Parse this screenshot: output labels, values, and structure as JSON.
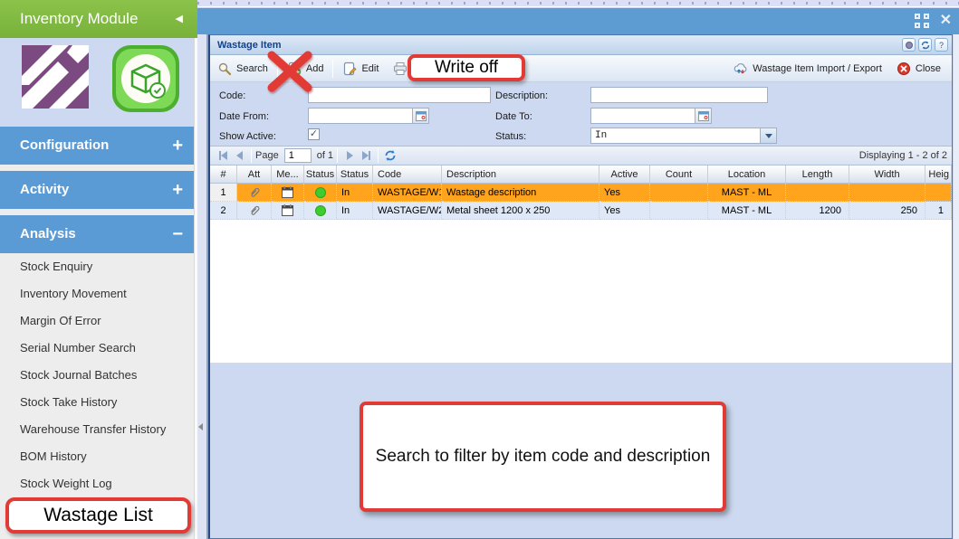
{
  "sidebar": {
    "title": "Inventory Module",
    "collapse_glyph": "◀",
    "sections": [
      {
        "label": "Configuration",
        "state_glyph": "+"
      },
      {
        "label": "Activity",
        "state_glyph": "+"
      },
      {
        "label": "Analysis",
        "state_glyph": "−"
      }
    ],
    "analysis_items": [
      "Stock Enquiry",
      "Inventory Movement",
      "Margin Of Error",
      "Serial Number Search",
      "Stock Journal Batches",
      "Stock Take History",
      "Warehouse Transfer History",
      "BOM History",
      "Stock Weight Log"
    ]
  },
  "window": {
    "close_glyph": "✕"
  },
  "panel": {
    "title": "Wastage Item",
    "header_buttons": {
      "help_label": "?"
    },
    "toolbar": {
      "search": "Search",
      "add": "Add",
      "edit": "Edit",
      "print_grid": "Print Grid",
      "import_export": "Wastage Item Import / Export",
      "close": "Close"
    },
    "filters": {
      "code_label": "Code:",
      "code_value": "",
      "description_label": "Description:",
      "description_value": "",
      "date_from_label": "Date From:",
      "date_from_value": "",
      "date_to_label": "Date To:",
      "date_to_value": "",
      "show_active_label": "Show Active:",
      "show_active_check": "✓",
      "status_label": "Status:",
      "status_value": "In"
    },
    "pager": {
      "page_label": "Page",
      "page_value": "1",
      "of_label": "of 1",
      "displaying": "Displaying 1 - 2 of 2"
    },
    "grid": {
      "columns": [
        "#",
        "Att",
        "Me...",
        "Status",
        "Status",
        "Code",
        "Description",
        "Active",
        "Count",
        "Location",
        "Length",
        "Width",
        "Heig"
      ],
      "rows": [
        {
          "num": "1",
          "status_text": "In",
          "code": "WASTAGE/W1",
          "description": "Wastage description",
          "active": "Yes",
          "count": "",
          "location": "MAST - ML",
          "length": "",
          "width": "",
          "height": ""
        },
        {
          "num": "2",
          "status_text": "In",
          "code": "WASTAGE/W2",
          "description": "Metal sheet 1200 x 250",
          "active": "Yes",
          "count": "",
          "location": "MAST - ML",
          "length": "1200",
          "width": "250",
          "height": "1"
        }
      ]
    }
  },
  "annotations": {
    "write_off": "Write off",
    "wastage_list": "Wastage List",
    "callout": "Search to filter by item code and description"
  },
  "colors": {
    "sidebar_green": "#7fbc42",
    "section_blue": "#5b9bd5",
    "titlebar_blue": "#5d9bd3",
    "selected_row_orange": "#ffa41c",
    "annotation_red": "#e23b36",
    "status_green": "#3ecc2e",
    "panel_bg": "#ccd9f0"
  }
}
